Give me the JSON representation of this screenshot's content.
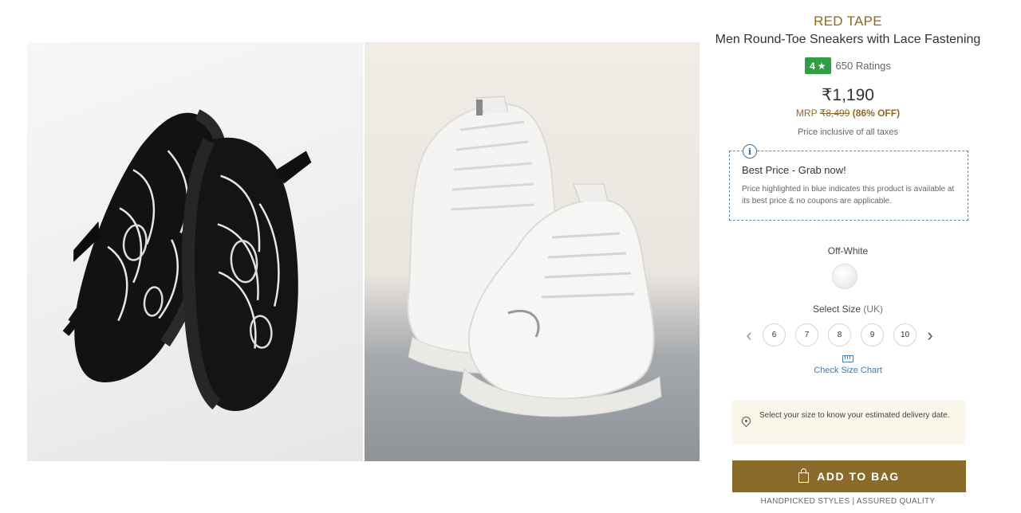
{
  "gallery": {
    "images": [
      {
        "alt": "Black sneakers pair"
      },
      {
        "alt": "Off-white sneakers pair"
      }
    ]
  },
  "product": {
    "brand": "RED TAPE",
    "title": "Men Round-Toe Sneakers with Lace Fastening",
    "rating": "4",
    "rating_star": "★",
    "ratings_count": "650 Ratings",
    "price": "₹1,190",
    "mrp_label": "MRP",
    "mrp_value": "₹8,499",
    "discount": "(86% OFF)",
    "tax_note": "Price inclusive of all taxes"
  },
  "best_price": {
    "icon_glyph": "i",
    "title": "Best Price - Grab now!",
    "description": "Price highlighted in blue indicates this product is available at its best price & no coupons are applicable."
  },
  "color": {
    "label": "Off-White",
    "swatch_color": "#f3f2f0"
  },
  "size": {
    "label": "Select Size",
    "unit": "(UK)",
    "prev_glyph": "‹",
    "next_glyph": "›",
    "options": [
      "6",
      "7",
      "8",
      "9",
      "10"
    ],
    "chart_link": "Check Size Chart"
  },
  "delivery": {
    "text": "Select your size to know your estimated delivery date."
  },
  "cta": {
    "add_to_bag": "ADD TO BAG"
  },
  "footer": {
    "note": "HANDPICKED STYLES | ASSURED QUALITY"
  },
  "colors": {
    "brand_gold": "#8a6b2a",
    "rating_green": "#2f9e44",
    "link_blue": "#3d79ae",
    "delivery_bg": "#fbf6ea"
  }
}
